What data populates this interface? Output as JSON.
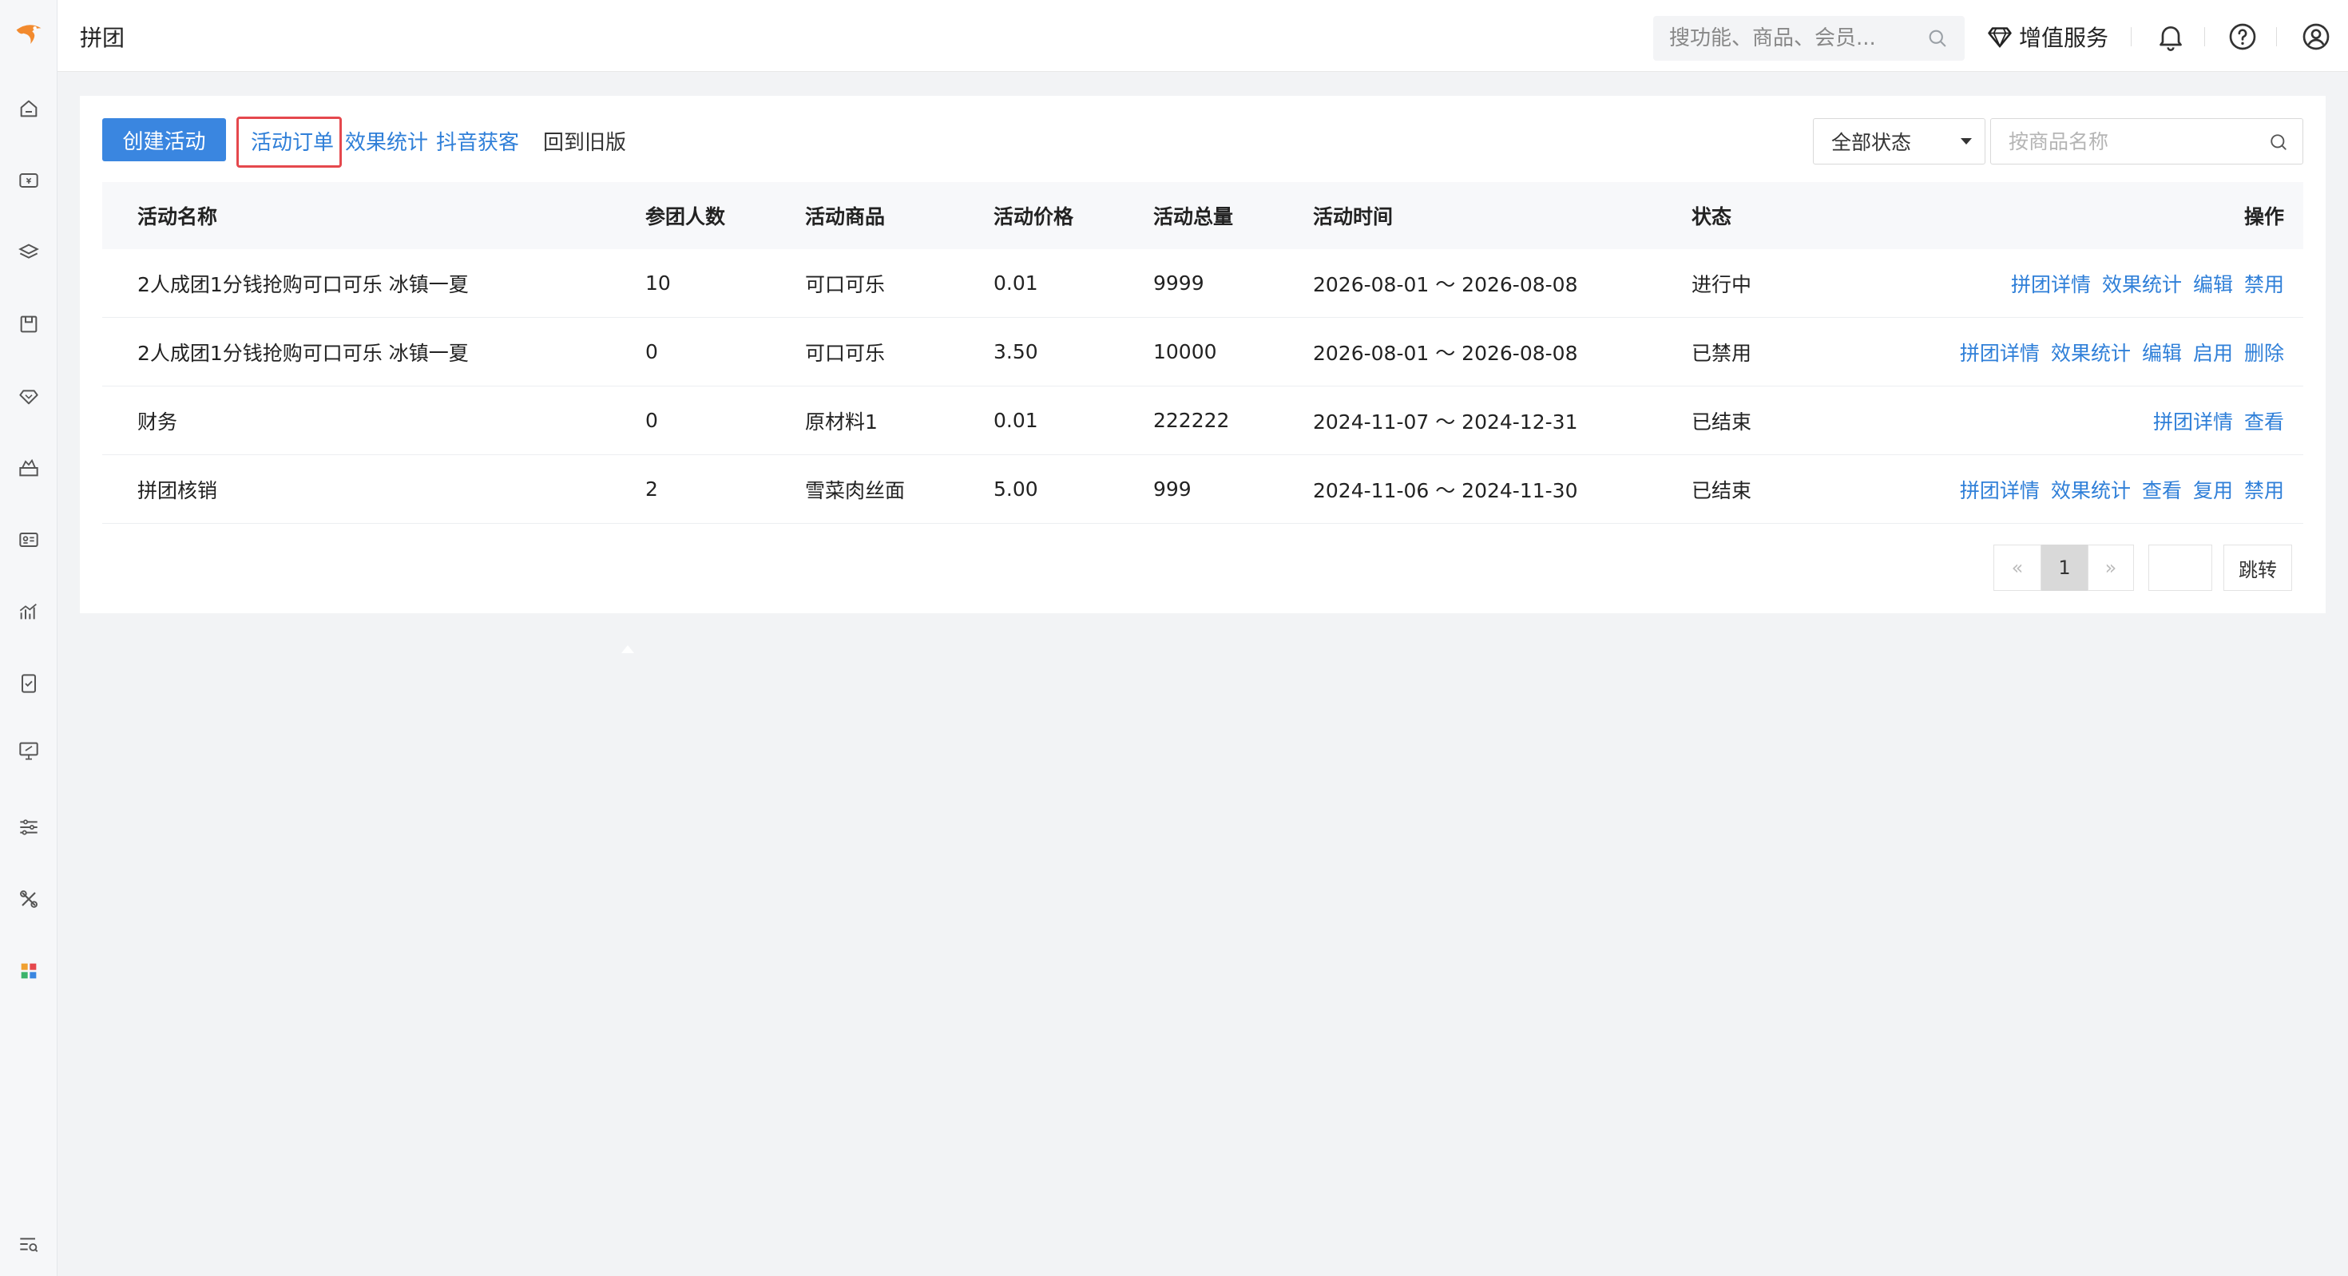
{
  "header": {
    "title": "拼团",
    "search_placeholder": "搜功能、商品、会员...",
    "vas_label": "增值服务"
  },
  "sidebar": {
    "icons": [
      "home-icon",
      "wallet-icon",
      "coupon-icon",
      "store-icon",
      "diamond-icon",
      "marketing-icon",
      "member-card-icon",
      "chart-icon",
      "report-icon",
      "monitor-icon",
      "settings-sliders-icon",
      "tools-icon",
      "apps-grid-icon",
      "search-list-icon"
    ]
  },
  "toolbar": {
    "create_label": "创建活动",
    "tabs": [
      {
        "label": "活动订单"
      },
      {
        "label": "效果统计"
      },
      {
        "label": "抖音获客"
      },
      {
        "label": "回到旧版"
      }
    ],
    "status_select": "全部状态",
    "product_search_placeholder": "按商品名称"
  },
  "table": {
    "headers": [
      "活动名称",
      "参团人数",
      "活动商品",
      "活动价格",
      "活动总量",
      "活动时间",
      "状态",
      "操作"
    ],
    "rows": [
      {
        "name": "2人成团1分钱抢购可口可乐 冰镇一夏",
        "count": "10",
        "product": "可口可乐",
        "price": "0.01",
        "total": "9999",
        "time": "2026-08-01 ～ 2026-08-08",
        "status": "进行中",
        "ops": [
          "拼团详情",
          "效果统计",
          "编辑",
          "禁用"
        ]
      },
      {
        "name": "2人成团1分钱抢购可口可乐 冰镇一夏",
        "count": "0",
        "product": "可口可乐",
        "price": "3.50",
        "total": "10000",
        "time": "2026-08-01 ～ 2026-08-08",
        "status": "已禁用",
        "ops": [
          "拼团详情",
          "效果统计",
          "编辑",
          "启用",
          "删除"
        ]
      },
      {
        "name": "财务",
        "count": "0",
        "product": "原材料1",
        "price": "0.01",
        "total": "222222",
        "time": "2024-11-07 ～ 2024-12-31",
        "status": "已结束",
        "ops": [
          "拼团详情",
          "查看"
        ]
      },
      {
        "name": "拼团核销",
        "count": "2",
        "product": "雪菜肉丝面",
        "price": "5.00",
        "total": "999",
        "time": "2024-11-06 ～ 2024-11-30",
        "status": "已结束",
        "ops": [
          "拼团详情",
          "效果统计",
          "查看",
          "复用",
          "禁用"
        ]
      }
    ]
  },
  "pagination": {
    "prev": "«",
    "current": "1",
    "next": "»",
    "jump_label": "跳转"
  },
  "colors": {
    "primary": "#3a86e0",
    "link": "#2f7fd8",
    "highlight_box": "#e5484d"
  }
}
